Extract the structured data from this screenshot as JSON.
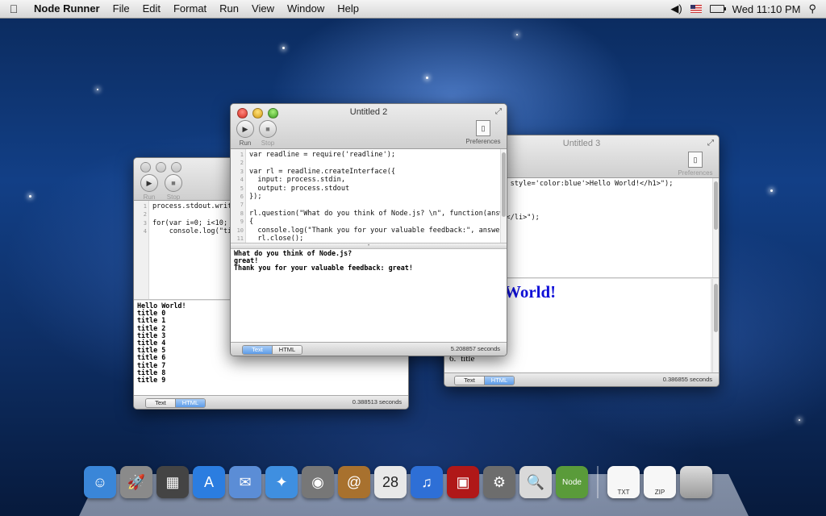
{
  "menubar": {
    "app_name": "Node Runner",
    "items": [
      "File",
      "Edit",
      "Format",
      "Run",
      "View",
      "Window",
      "Help"
    ],
    "clock": "Wed 11:10 PM",
    "icons": [
      "apple-icon",
      "volume-icon",
      "us-flag-icon",
      "battery-icon",
      "spotlight-search-icon"
    ]
  },
  "toolbar": {
    "run_label": "Run",
    "stop_label": "Stop",
    "prefs_label": "Preferences"
  },
  "left_window": {
    "title": "",
    "code": [
      {
        "n": "1",
        "t": "process.stdout.write("
      },
      {
        "n": "2",
        "t": ""
      },
      {
        "n": "3",
        "t": "for(var i=0; i<10; i++"
      },
      {
        "n": "4",
        "t": "    console.log(\"title"
      }
    ],
    "output": [
      "Hello World!",
      "title 0",
      "title 1",
      "title 2",
      "title 3",
      "title 4",
      "title 5",
      "title 6",
      "title 7",
      "title 8",
      "title 9"
    ],
    "tabs": [
      "Text",
      "HTML"
    ],
    "selected_tab": "HTML",
    "timing": "0.388513 seconds"
  },
  "center_window": {
    "title": "Untitled 2",
    "code": [
      {
        "n": "1",
        "t": "var readline = require('readline');"
      },
      {
        "n": "2",
        "t": ""
      },
      {
        "n": "3",
        "t": "var rl = readline.createInterface({"
      },
      {
        "n": "4",
        "t": "  input: process.stdin,"
      },
      {
        "n": "5",
        "t": "  output: process.stdout"
      },
      {
        "n": "6",
        "t": "});"
      },
      {
        "n": "7",
        "t": ""
      },
      {
        "n": "8",
        "t": "rl.question(\"What do you think of Node.js? \\n\", function(answer)"
      },
      {
        "n": "9",
        "t": "{"
      },
      {
        "n": "10",
        "t": "  console.log(\"Thank you for your valuable feedback:\", answer);"
      },
      {
        "n": "11",
        "t": "  rl.close();"
      }
    ],
    "output": [
      "What do you think of Node.js?",
      "great!",
      "Thank you for your valuable feedback: great!"
    ],
    "tabs": [
      "Text",
      "HTML"
    ],
    "selected_tab": "Text",
    "timing": "5.208857 seconds"
  },
  "right_window": {
    "title": "Untitled 3",
    "code": [
      {
        "n": "",
        "t": "out.write(\"<h1 style='color:blue'>Hello World!</h1>\");"
      },
      {
        "n": "",
        "t": ""
      },
      {
        "n": "",
        "t": "\"<ol>\");"
      },
      {
        "n": "",
        "t": " i<10; i++)"
      },
      {
        "n": "",
        "t": "log(\"<li>title</li>\");"
      },
      {
        "n": "",
        "t": "\"</ol>\");"
      }
    ],
    "html_heading": "World!",
    "html_list": [
      {
        "num": "5.",
        "text": "title"
      },
      {
        "num": "6.",
        "text": "title"
      }
    ],
    "tabs": [
      "Text",
      "HTML"
    ],
    "selected_tab": "HTML",
    "timing": "0.386855 seconds"
  },
  "dock": {
    "apps": [
      {
        "name": "finder-icon",
        "glyph": "☺",
        "color": "#3a86d8"
      },
      {
        "name": "launchpad-icon",
        "glyph": "🚀",
        "color": "#8a8a8a"
      },
      {
        "name": "mission-control-icon",
        "glyph": "▦",
        "color": "#444"
      },
      {
        "name": "app-store-icon",
        "glyph": "A",
        "color": "#2b7de0"
      },
      {
        "name": "mail-icon",
        "glyph": "✉",
        "color": "#5b8dd6"
      },
      {
        "name": "safari-icon",
        "glyph": "✦",
        "color": "#3f8fe0"
      },
      {
        "name": "facetime-icon",
        "glyph": "◉",
        "color": "#777"
      },
      {
        "name": "address-book-icon",
        "glyph": "@",
        "color": "#a8712e"
      },
      {
        "name": "ical-icon",
        "glyph": "28",
        "color": "#e8e8e8"
      },
      {
        "name": "itunes-icon",
        "glyph": "♫",
        "color": "#2e6fd6"
      },
      {
        "name": "photo-booth-icon",
        "glyph": "▣",
        "color": "#b01818"
      },
      {
        "name": "system-preferences-icon",
        "glyph": "⚙",
        "color": "#6d6d6d"
      },
      {
        "name": "preview-icon",
        "glyph": "🔍",
        "color": "#d9d9d9"
      },
      {
        "name": "node-runner-icon",
        "glyph": "Node",
        "color": "#5a9b3a"
      }
    ],
    "docs": [
      {
        "name": "txt-document-icon",
        "label": "TXT"
      },
      {
        "name": "zip-archive-icon",
        "label": "ZIP"
      },
      {
        "name": "trash-icon",
        "label": ""
      }
    ]
  }
}
